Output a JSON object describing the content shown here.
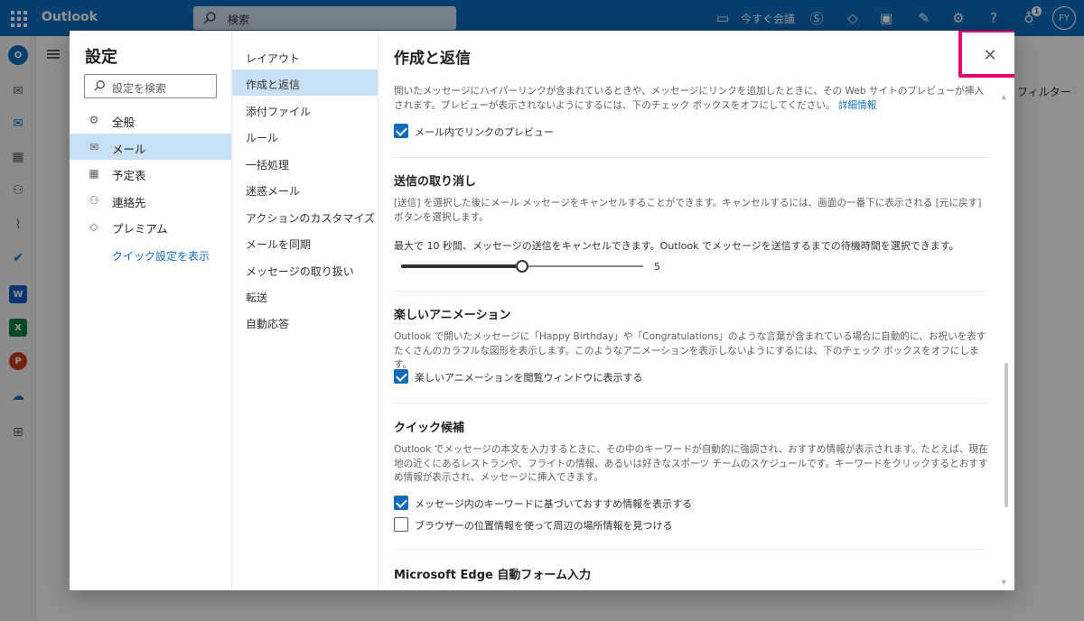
{
  "topbar": {
    "brand": "Outlook",
    "search_placeholder": "検索",
    "meet_now": "今すぐ会議",
    "avatar_initials": "FY",
    "notif_count": "1"
  },
  "background": {
    "filter_label": "フィルター"
  },
  "settings": {
    "title": "設定",
    "search_placeholder": "設定を検索",
    "categories": [
      {
        "label": "全般",
        "icon": "gear-icon"
      },
      {
        "label": "メール",
        "icon": "mail-icon"
      },
      {
        "label": "予定表",
        "icon": "calendar-icon"
      },
      {
        "label": "連絡先",
        "icon": "people-icon"
      },
      {
        "label": "プレミアム",
        "icon": "diamond-icon"
      }
    ],
    "quick_settings_link": "クイック設定を表示",
    "subcategories": [
      "レイアウト",
      "作成と返信",
      "添付ファイル",
      "ルール",
      "一括処理",
      "迷惑メール",
      "アクションのカスタマイズ",
      "メールを同期",
      "メッセージの取り扱い",
      "転送",
      "自動応答"
    ],
    "active_category": "メール",
    "active_subcategory": "作成と返信"
  },
  "pane": {
    "title": "作成と返信",
    "link_preview": {
      "desc": "開いたメッセージにハイパーリンクが含まれているときや、メッセージにリンクを追加したときに、その Web サイトのプレビューが挿入されます。プレビューが表示されないようにするには、下のチェック ボックスをオフにしてください。",
      "more_link": "詳細情報",
      "checkbox_label": "メール内でリンクのプレビュー",
      "checked": true
    },
    "undo_send": {
      "title": "送信の取り消し",
      "desc": "[送信] を選択した後にメール メッセージをキャンセルすることができます。キャンセルするには、画面の一番下に表示される [元に戻す] ボタンを選択します。",
      "info": "最大で 10 秒間、メッセージの送信をキャンセルできます。Outlook でメッセージを送信するまでの待機時間を選択できます。",
      "slider_value": "5",
      "slider_fraction": 0.5
    },
    "animations": {
      "title": "楽しいアニメーション",
      "desc": "Outlook で開いたメッセージに「Happy Birthday」や「Congratulations」のような言葉が含まれている場合に自動的に、お祝いを表すたくさんのカラフルな図形を表示します。このようなアニメーションを表示しないようにするには、下のチェック ボックスをオフにします。",
      "checkbox_label": "楽しいアニメーションを閲覧ウィンドウに表示する",
      "checked": true
    },
    "suggestions": {
      "title": "クイック候補",
      "desc": "Outlook でメッセージの本文を入力するときに、その中のキーワードが自動的に強調され、おすすめ情報が表示されます。たとえば、現在地の近くにあるレストランや、フライトの情報、あるいは好きなスポーツ チームのスケジュールです。キーワードをクリックするとおすすめ情報が表示され、メッセージに挿入できます。",
      "checkbox1_label": "メッセージ内のキーワードに基づいておすすめ情報を表示する",
      "checkbox1_checked": true,
      "checkbox2_label": "ブラウザーの位置情報を使って周辺の場所情報を見つける",
      "checkbox2_checked": false
    },
    "edge_autofill": {
      "title": "Microsoft Edge 自動フォーム入力"
    }
  },
  "colors": {
    "brand": "#0f6cbd",
    "highlight": "#e3006a",
    "selection": "#c7e0f4"
  }
}
